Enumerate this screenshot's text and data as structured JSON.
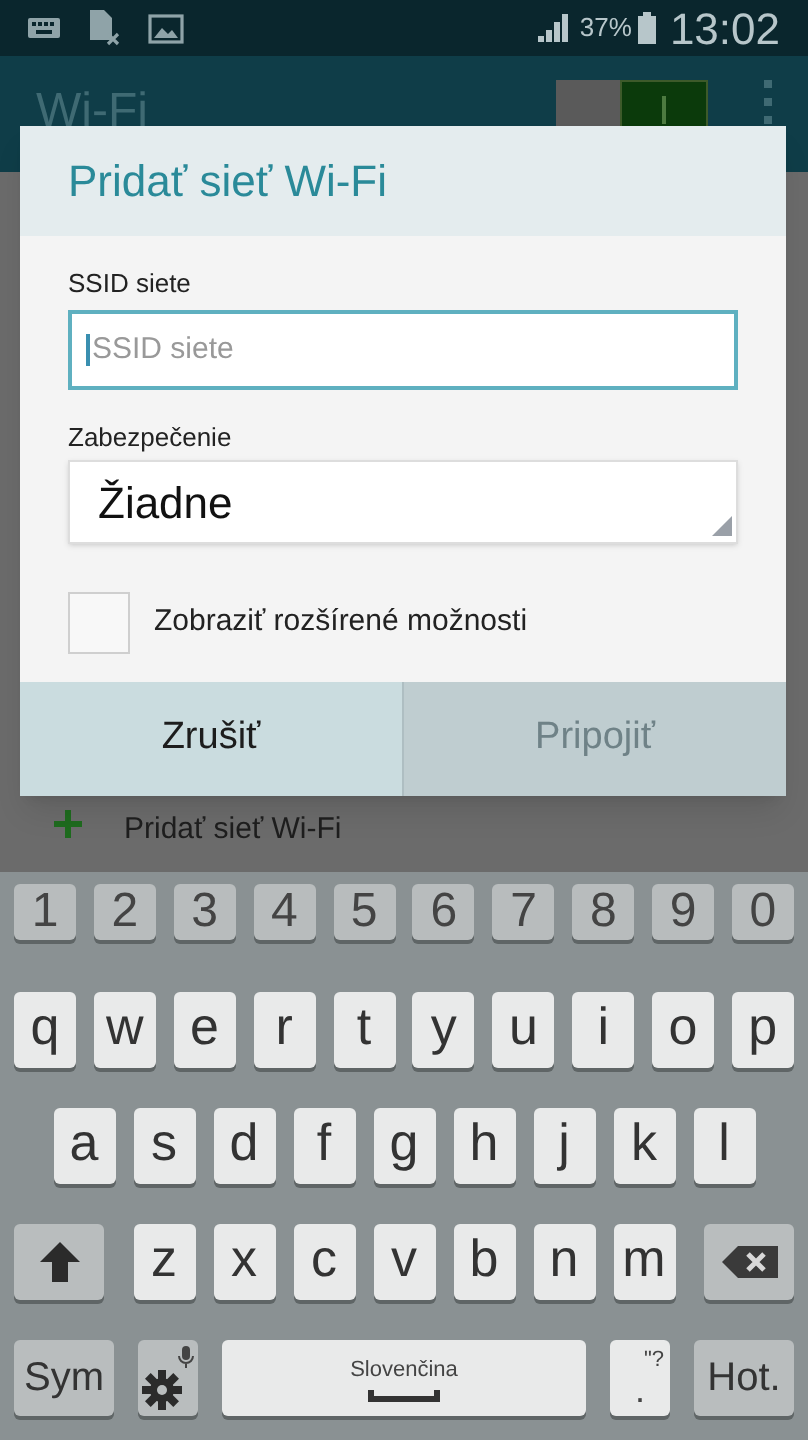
{
  "status_bar": {
    "battery": "37%",
    "time": "13:02"
  },
  "app_bar": {
    "title": "Wi-Fi",
    "switch_on": true
  },
  "background_item": {
    "label": "Pridať sieť Wi-Fi"
  },
  "dialog": {
    "title": "Pridať sieť Wi-Fi",
    "ssid": {
      "label": "SSID siete",
      "placeholder": "SSID siete",
      "focused": true
    },
    "security": {
      "label": "Zabezpečenie",
      "value": "Žiadne"
    },
    "advanced": {
      "label": "Zobraziť rozšírené možnosti",
      "checked": false
    },
    "buttons": [
      {
        "label": "Zrušiť",
        "disabled": false
      },
      {
        "label": "Pripojiť",
        "disabled": true
      }
    ]
  },
  "keyboard": {
    "rows": [
      {
        "keys": [
          {
            "kind": "number",
            "label": "1"
          },
          {
            "kind": "number",
            "label": "2"
          },
          {
            "kind": "number",
            "label": "3"
          },
          {
            "kind": "number",
            "label": "4"
          },
          {
            "kind": "number",
            "label": "5"
          },
          {
            "kind": "number",
            "label": "6"
          },
          {
            "kind": "number",
            "label": "7"
          },
          {
            "kind": "number",
            "label": "8"
          },
          {
            "kind": "number",
            "label": "9"
          },
          {
            "kind": "number",
            "label": "0"
          }
        ]
      },
      {
        "keys": [
          {
            "kind": "char",
            "label": "q"
          },
          {
            "kind": "char",
            "label": "w"
          },
          {
            "kind": "char",
            "label": "e"
          },
          {
            "kind": "char",
            "label": "r"
          },
          {
            "kind": "char",
            "label": "t"
          },
          {
            "kind": "char",
            "label": "y"
          },
          {
            "kind": "char",
            "label": "u"
          },
          {
            "kind": "char",
            "label": "i"
          },
          {
            "kind": "char",
            "label": "o"
          },
          {
            "kind": "char",
            "label": "p"
          }
        ]
      },
      {
        "keys": [
          {
            "kind": "char",
            "label": "a"
          },
          {
            "kind": "char",
            "label": "s"
          },
          {
            "kind": "char",
            "label": "d"
          },
          {
            "kind": "char",
            "label": "f"
          },
          {
            "kind": "char",
            "label": "g"
          },
          {
            "kind": "char",
            "label": "h"
          },
          {
            "kind": "char",
            "label": "j"
          },
          {
            "kind": "char",
            "label": "k"
          },
          {
            "kind": "char",
            "label": "l"
          }
        ]
      },
      {
        "keys": [
          {
            "kind": "shift"
          },
          {
            "kind": "char",
            "label": "z"
          },
          {
            "kind": "char",
            "label": "x"
          },
          {
            "kind": "char",
            "label": "c"
          },
          {
            "kind": "char",
            "label": "v"
          },
          {
            "kind": "char",
            "label": "b"
          },
          {
            "kind": "char",
            "label": "n"
          },
          {
            "kind": "char",
            "label": "m"
          },
          {
            "kind": "backspace"
          }
        ]
      },
      {
        "keys": [
          {
            "kind": "sym",
            "label": "Sym"
          },
          {
            "kind": "settings"
          },
          {
            "kind": "space",
            "label": "Slovenčina"
          },
          {
            "kind": "punct",
            "label": ".",
            "hint": "\"?"
          },
          {
            "kind": "enter",
            "label": "Hot."
          }
        ]
      }
    ]
  }
}
